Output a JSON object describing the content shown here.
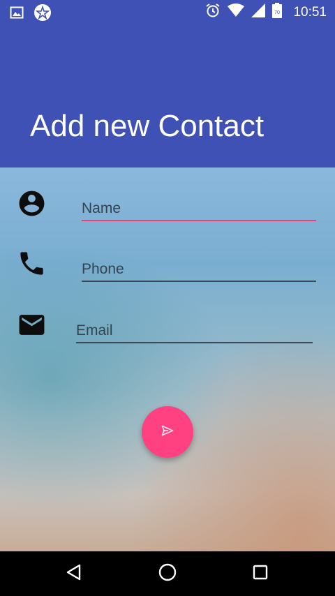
{
  "status_bar": {
    "time": "10:51",
    "battery_level": "70",
    "icons": [
      "image-icon",
      "app-icon",
      "alarm-icon",
      "wifi-icon",
      "signal-icon",
      "battery-icon"
    ]
  },
  "header": {
    "title": "Add new Contact"
  },
  "form": {
    "name": {
      "placeholder": "Name",
      "value": "",
      "icon": "person-icon"
    },
    "phone": {
      "placeholder": "Phone",
      "value": "",
      "icon": "phone-icon"
    },
    "email": {
      "placeholder": "Email",
      "value": "",
      "icon": "email-icon"
    }
  },
  "fab": {
    "icon": "send-icon"
  },
  "navigation": {
    "icons": [
      "back-icon",
      "home-icon",
      "recents-icon"
    ]
  },
  "colors": {
    "primary": "#3f51b5",
    "accent": "#ff4081",
    "field_active": "#ef3f72"
  }
}
